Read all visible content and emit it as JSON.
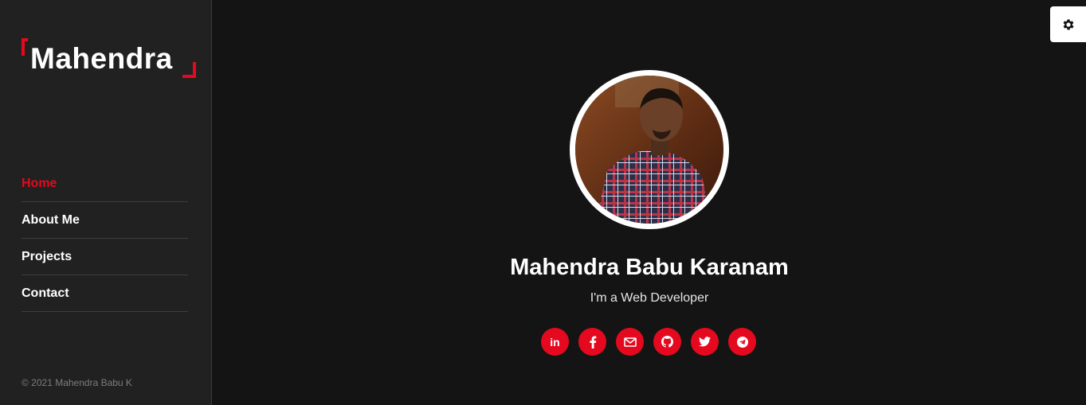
{
  "sidebar": {
    "logo": "Mahendra",
    "nav": [
      {
        "label": "Home",
        "active": true
      },
      {
        "label": "About Me"
      },
      {
        "label": "Projects"
      },
      {
        "label": "Contact"
      }
    ],
    "footer": "© 2021 Mahendra Babu K"
  },
  "profile": {
    "name": "Mahendra Babu Karanam",
    "role": "I'm a Web Developer"
  },
  "social": {
    "icons": [
      "linkedin-icon",
      "facebook-icon",
      "email-icon",
      "github-icon",
      "twitter-icon",
      "telegram-icon"
    ],
    "linkedin_glyph": "in"
  },
  "colors": {
    "accent": "#e5091f",
    "sidebar_bg": "#212121",
    "main_bg": "#141414"
  }
}
